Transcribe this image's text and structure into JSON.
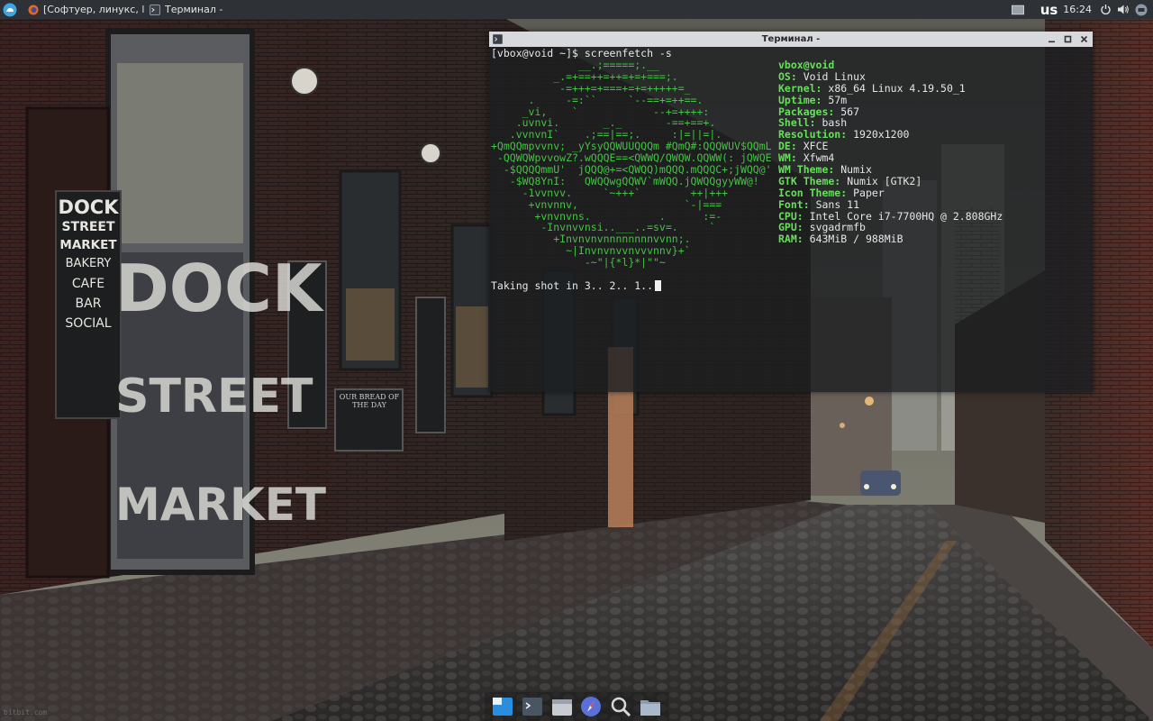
{
  "top_panel": {
    "tasks": [
      {
        "label": "[Софтуер, линукс, l...",
        "icon": "firefox-icon"
      },
      {
        "label": "Терминал -",
        "icon": "terminal-icon"
      }
    ],
    "keyboard_layout": "us",
    "clock": "16:24"
  },
  "terminal": {
    "title": "Терминал -",
    "prompt": "[vbox@void ~]$ screenfetch -s",
    "logo_lines": [
      "              __.;=====;.__",
      "          _.=+==++=++=+=+===;.",
      "           -=+++=+===+=+=+++++=_",
      "      .     -=:``     `--==+=++==.",
      "     _vi,    `            --+=++++:",
      "    .uvnvi.       _._       -==+==+.",
      "   .vvnvnI`    .;==|==;.     :|=||=|.",
      "+QmQQmpvvnv; _yYsyQQWUUQQQm #QmQ#:QQQWUV$QQmL",
      " -QQWQWpvvowZ?.wQQQE==<QWWQ/QWQW.QQWW(: jQWQE",
      "  -$QQQQmmU'  jQQQ@+=<QWQQ)mQQQ.mQQQC+;jWQQ@'",
      "   -$WQ8YnI:   QWQQwgQQWV`mWQQ.jQWQQgyyWW@!",
      "     -1vvnvv.     `~+++`        ++|+++",
      "      +vnvnnv,                 `-|===",
      "       +vnvnvns.           .      :=-",
      "        -Invnvvnsi..___..=sv=.     `",
      "          +Invnvnvnnnnnnnnvvnn;.",
      "            ~|Invnvnvvnvvvnnv}+`",
      "               -~\"|{*l}*|\"\"~"
    ],
    "info": {
      "user_host": "vbox@void",
      "rows": [
        {
          "key": "OS:",
          "value": "Void Linux"
        },
        {
          "key": "Kernel:",
          "value": "x86_64 Linux 4.19.50_1"
        },
        {
          "key": "Uptime:",
          "value": "57m"
        },
        {
          "key": "Packages:",
          "value": "567"
        },
        {
          "key": "Shell:",
          "value": "bash"
        },
        {
          "key": "Resolution:",
          "value": "1920x1200"
        },
        {
          "key": "DE:",
          "value": "XFCE"
        },
        {
          "key": "WM:",
          "value": "Xfwm4"
        },
        {
          "key": "WM Theme:",
          "value": "Numix"
        },
        {
          "key": "GTK Theme:",
          "value": "Numix [GTK2]"
        },
        {
          "key": "Icon Theme:",
          "value": "Paper"
        },
        {
          "key": "Font:",
          "value": "Sans 11"
        },
        {
          "key": "CPU:",
          "value": "Intel Core i7-7700HQ @ 2.808GHz"
        },
        {
          "key": "GPU:",
          "value": "svgadrmfb"
        },
        {
          "key": "RAM:",
          "value": "643MiB / 988MiB"
        }
      ]
    },
    "shot_text": "Taking shot in 3.. 2.. 1.."
  },
  "wallpaper": {
    "sign_lines": [
      "DOCK",
      "STREET",
      "MARKET",
      "BAKERY",
      "CAFE",
      "BAR",
      "SOCIAL"
    ],
    "window_text": [
      "DOCK",
      "STREET",
      "MARKET"
    ],
    "board_text": "OUR BREAD OF THE DAY"
  },
  "dock": {
    "items": [
      "file-manager-icon",
      "terminal-icon",
      "files-icon",
      "web-browser-icon",
      "search-icon",
      "folder-icon"
    ]
  },
  "watermark": "bitbit.com",
  "colors": {
    "panel": "#2e3135",
    "terminal_green": "#45c145",
    "info_key": "#66e05a",
    "titlebar": "#d7d9dc"
  }
}
